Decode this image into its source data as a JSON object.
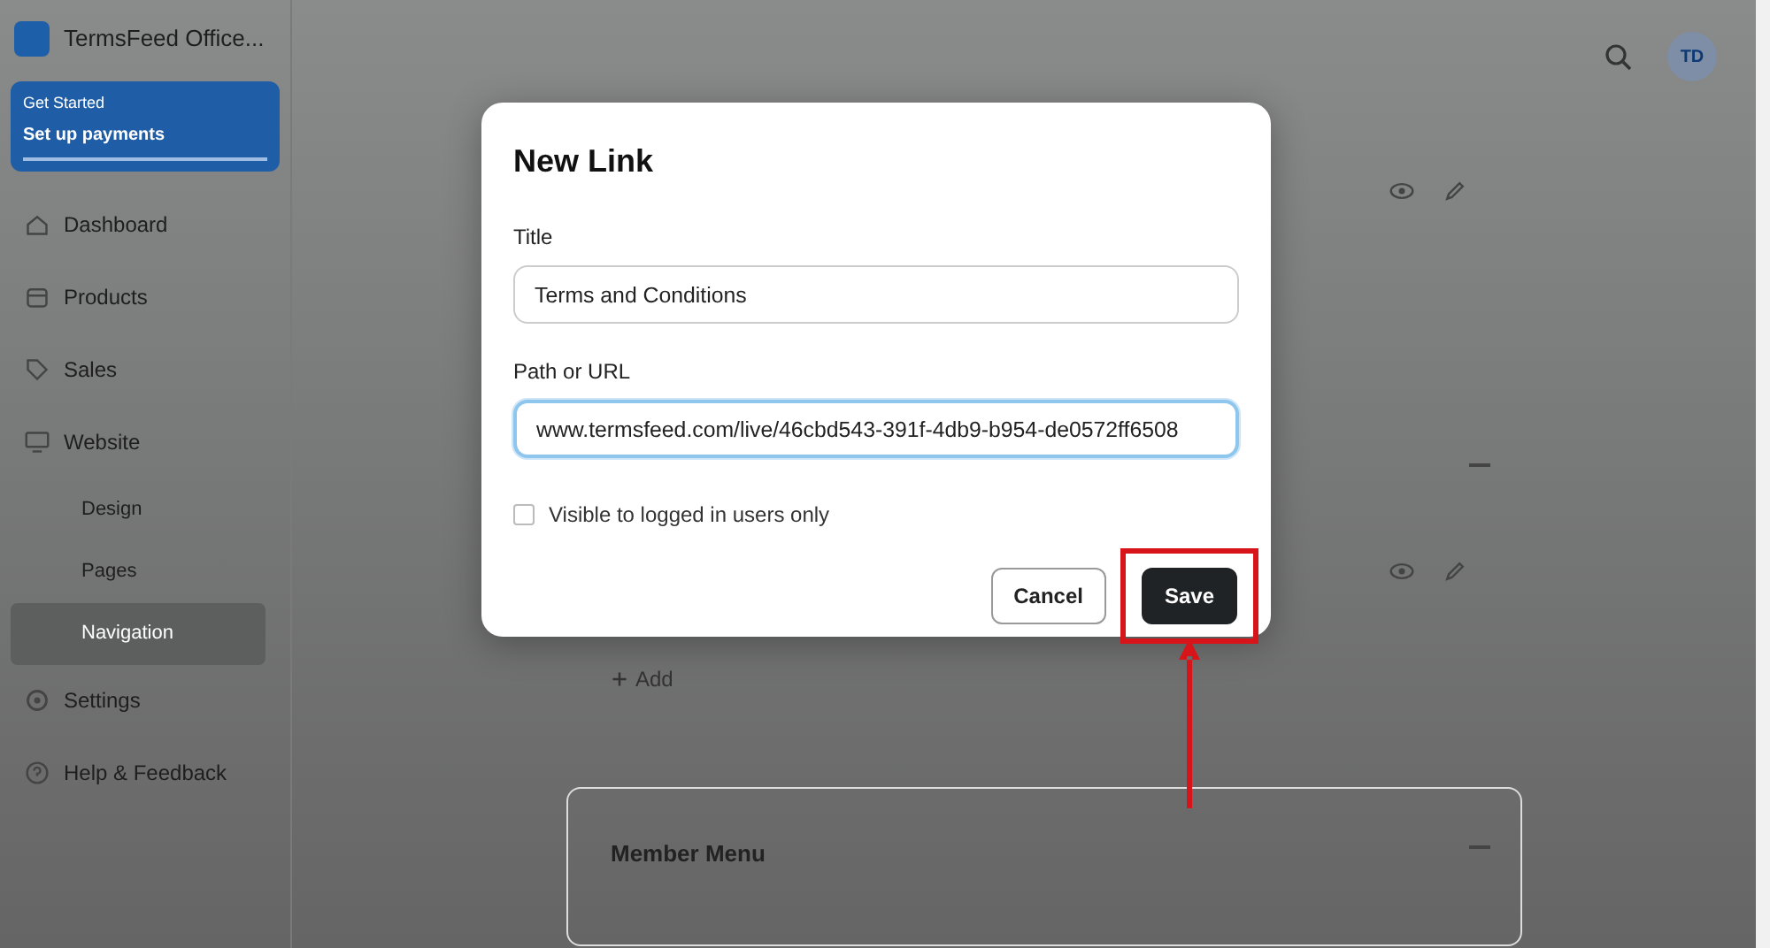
{
  "app": {
    "title": "TermsFeed Office...",
    "avatar": "TD"
  },
  "banner": {
    "label": "Get Started",
    "title": "Set up payments"
  },
  "sidebar": {
    "items": [
      {
        "label": "Dashboard"
      },
      {
        "label": "Products"
      },
      {
        "label": "Sales"
      },
      {
        "label": "Website",
        "children": [
          {
            "label": "Design",
            "selected": false
          },
          {
            "label": "Pages",
            "selected": false
          },
          {
            "label": "Navigation",
            "selected": true
          }
        ]
      },
      {
        "label": "Settings"
      },
      {
        "label": "Help & Feedback"
      }
    ]
  },
  "main": {
    "add_label": "Add",
    "member_menu": "Member Menu"
  },
  "modal": {
    "title": "New Link",
    "fields": [
      {
        "label": "Title",
        "value": "Terms and Conditions",
        "focused": false
      },
      {
        "label": "Path or URL",
        "value": "www.termsfeed.com/live/46cbd543-391f-4db9-b954-de0572ff6508",
        "focused": true
      }
    ],
    "checkbox": {
      "label": "Visible to logged in users only",
      "checked": false
    },
    "buttons": [
      {
        "label": "Cancel",
        "kind": "secondary",
        "highlighted": false
      },
      {
        "label": "Save",
        "kind": "primary",
        "highlighted": true
      }
    ]
  }
}
